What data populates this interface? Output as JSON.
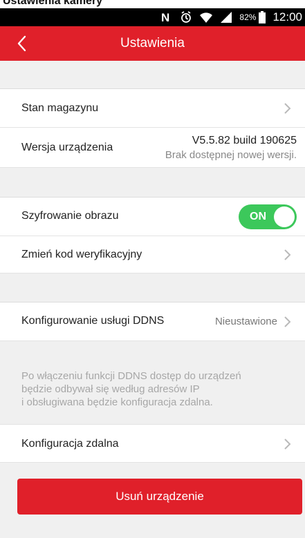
{
  "caption": "Ustawienia kamery",
  "status_bar": {
    "battery": "82%",
    "time": "12:00"
  },
  "header": {
    "title": "Ustawienia"
  },
  "storage": {
    "label": "Stan magazynu"
  },
  "device_version": {
    "label": "Wersja urządzenia",
    "version": "V5.5.82 build 190625",
    "update_status": "Brak dostępnej nowej wersji."
  },
  "encryption": {
    "label": "Szyfrowanie obrazu",
    "toggle_label": "ON"
  },
  "verification_code": {
    "label": "Zmień kod weryfikacyjny"
  },
  "ddns": {
    "label": "Konfigurowanie usługi DDNS",
    "value": "Nieustawione",
    "note": [
      "Po włączeniu funkcji DDNS dostęp do urządzeń",
      "będzie odbywał się według adresów IP",
      "i obsługiwana będzie konfiguracja zdalna."
    ]
  },
  "remote_config": {
    "label": "Konfiguracja zdalna"
  },
  "delete_button": {
    "label": "Usuń urządzenie"
  },
  "colors": {
    "accent": "#e0202a",
    "toggle_on": "#3cc85b"
  }
}
